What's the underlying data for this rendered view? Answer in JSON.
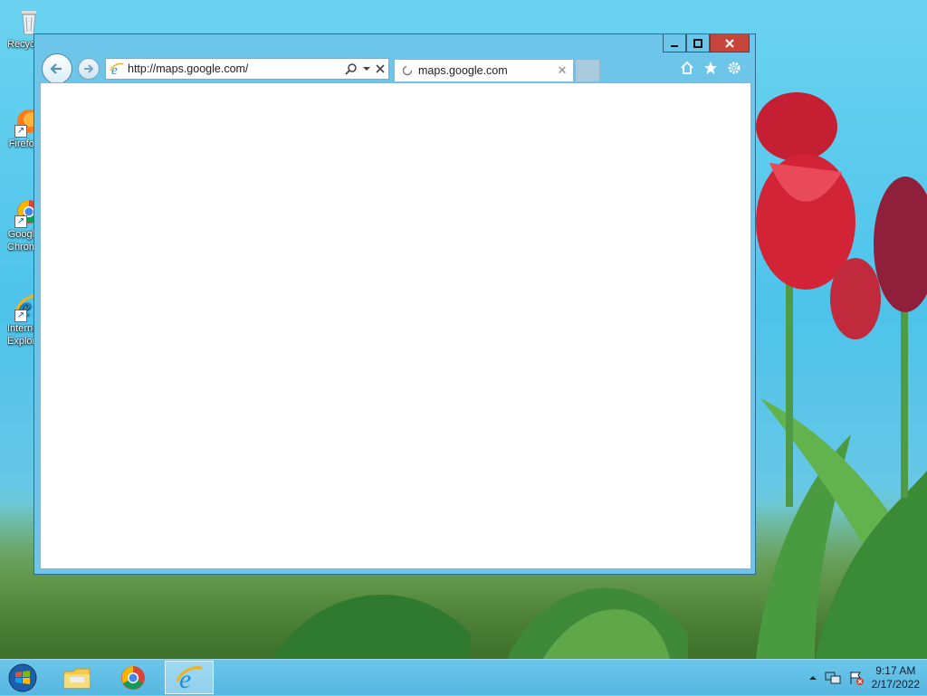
{
  "desktop": {
    "icons": [
      {
        "label": "Recycle Bin"
      },
      {
        "label": "Firefox"
      },
      {
        "label": "Google Chrome"
      },
      {
        "label": "Internet Explorer"
      }
    ]
  },
  "browser": {
    "address_url": "http://maps.google.com/",
    "tab_title": "maps.google.com",
    "icons": [
      "back-arrow-icon",
      "forward-arrow-icon",
      "ie-logo-icon",
      "search-icon",
      "dropdown-icon",
      "stop-icon",
      "home-icon",
      "favorites-star-icon",
      "settings-gear-icon"
    ]
  },
  "window_controls": {
    "minimize": "minimize",
    "maximize": "maximize",
    "close": "close"
  },
  "taskbar": {
    "items": [
      "start",
      "file-explorer",
      "google-chrome",
      "internet-explorer"
    ],
    "clock_time": "9:17 AM",
    "clock_date": "2/17/2022"
  },
  "colors": {
    "window_frame": "#6ec5ea",
    "close_button": "#c7463b",
    "taskbar": "#5fbfe6"
  }
}
